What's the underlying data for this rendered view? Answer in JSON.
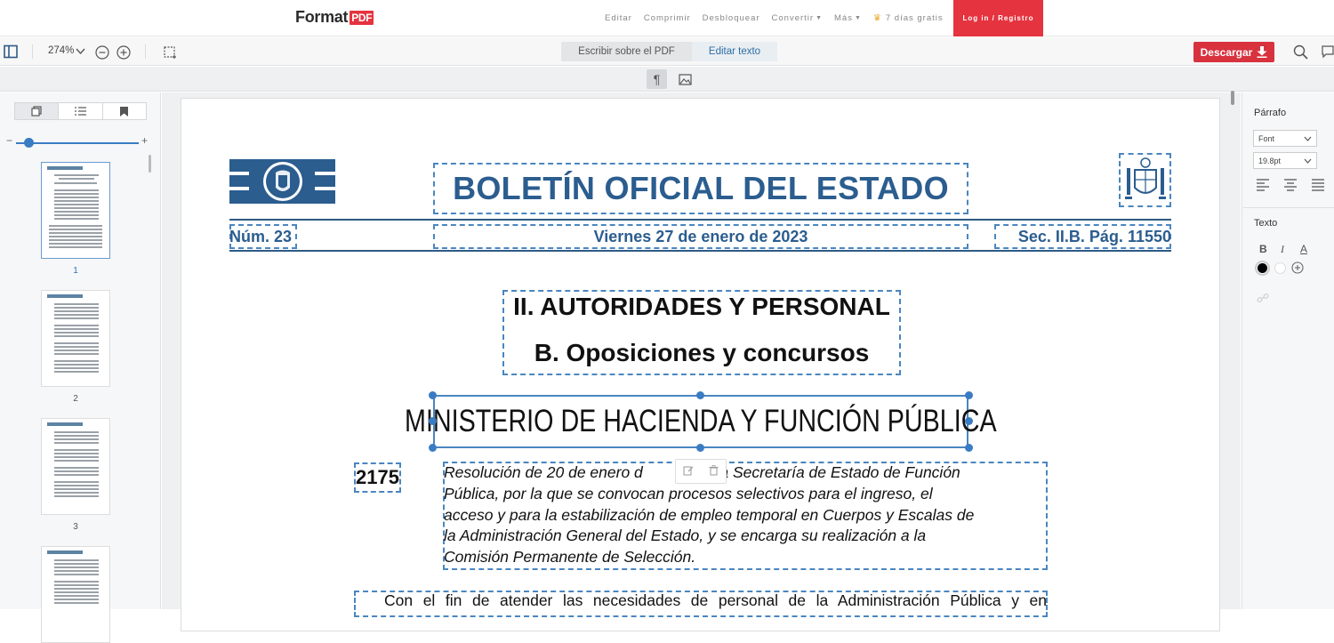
{
  "app": {
    "logo_text": "Format",
    "logo_badge": "PDF",
    "nav": {
      "items": [
        "Editar",
        "Comprimir",
        "Desbloquear",
        "Convertir",
        "Más"
      ],
      "trial": "7 días gratis",
      "login": "Log in / Registro"
    }
  },
  "toolbar": {
    "zoom": "274%",
    "mode_write": "Escribir sobre el PDF",
    "mode_edit": "Editar texto",
    "download": "Descargar"
  },
  "sidebar": {
    "pages": [
      "1",
      "2",
      "3"
    ],
    "selected_page": "1"
  },
  "document": {
    "title": "BOLETÍN OFICIAL DEL ESTADO",
    "number": "Núm. 23",
    "date": "Viernes 27 de enero de 2023",
    "section_page": "Sec. II.B.   Pág. 11550",
    "section1": "II. AUTORIDADES Y PERSONAL",
    "section2": "B. Oposiciones y concursos",
    "ministry": "MINISTERIO DE HACIENDA Y FUNCIÓN PÚBLICA",
    "entry_number": "2175",
    "resolution_lines": [
      "Resolución de 20 de enero d        3, de la Secretaría de Estado de Función",
      "Pública, por la que se convocan procesos selectivos para el ingreso, el",
      "acceso y para la estabilización de empleo temporal en Cuerpos y Escalas de",
      "la Administración General del Estado, y se encarga su realización a la",
      "Comisión Permanente de Selección."
    ],
    "paragraph_start": "Con el fin de atender las necesidades de personal de la Administración Pública y en"
  },
  "right_panel": {
    "paragraph_label": "Párrafo",
    "font_value": "Font",
    "size_value": "19.8pt",
    "text_label": "Texto",
    "bold": "B",
    "italic": "I",
    "underline": "A"
  },
  "colors": {
    "brand_red": "#e5333f",
    "accent_blue": "#3a7cc4",
    "boe_blue": "#2b5d8f"
  }
}
